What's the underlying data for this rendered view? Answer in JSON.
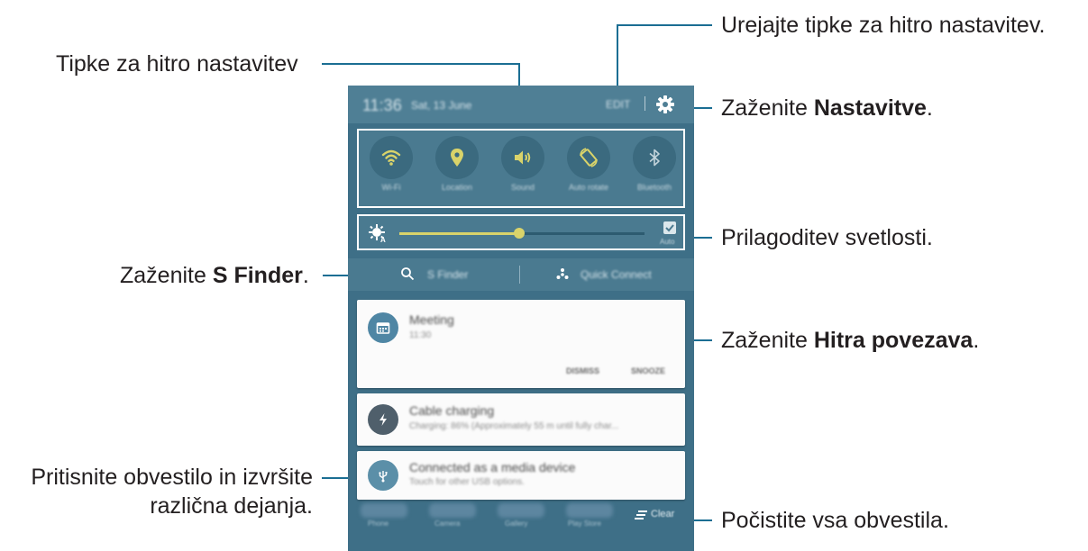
{
  "callouts": {
    "edit_quick": "Urejajte tipke za hitro nastavitev.",
    "quick_buttons": "Tipke za hitro nastavitev",
    "settings_prefix": "Zaženite ",
    "settings_bold": "Nastavitve",
    "settings_suffix": ".",
    "brightness": "Prilagoditev svetlosti.",
    "finder_prefix": "Zaženite ",
    "finder_bold": "S Finder",
    "finder_suffix": ".",
    "quick_connect_prefix": "Zaženite ",
    "quick_connect_bold": "Hitra povezava",
    "quick_connect_suffix": ".",
    "notification_line1": "Pritisnite obvestilo in izvršite",
    "notification_line2": "različna dejanja.",
    "clear_all": "Počistite vsa obvestila."
  },
  "status_bar": {
    "time": "11:36",
    "date": "Sat, 13 June",
    "edit_label": "EDIT"
  },
  "quick_settings": [
    {
      "label": "Wi-Fi",
      "icon": "wifi-icon",
      "active": true
    },
    {
      "label": "Location",
      "icon": "location-icon",
      "active": true
    },
    {
      "label": "Sound",
      "icon": "sound-icon",
      "active": true
    },
    {
      "label": "Auto rotate",
      "icon": "rotate-icon",
      "active": true
    },
    {
      "label": "Bluetooth",
      "icon": "bluetooth-icon",
      "active": false
    }
  ],
  "brightness": {
    "level": 0.49,
    "auto_label": "Auto",
    "auto_checked": true
  },
  "finder_bar": {
    "s_finder": "S Finder",
    "quick_connect": "Quick Connect"
  },
  "notifications": [
    {
      "title": "Meeting",
      "subtitle": "11:30",
      "icon": "calendar-icon",
      "actions": [
        "DISMISS",
        "SNOOZE"
      ]
    },
    {
      "title": "Cable charging",
      "subtitle": "Charging: 86% (Approximately 55 m until fully char...",
      "icon": "lightning-icon"
    },
    {
      "title": "Connected as a media device",
      "subtitle": "Touch for other USB options.",
      "icon": "usb-icon"
    }
  ],
  "dock_apps": [
    "Phone",
    "Camera",
    "Gallery",
    "Play Store"
  ],
  "clear_label": "Clear",
  "colors": {
    "accent": "#d9d36a",
    "panel": "#4a7a90",
    "background": "#3e6f87"
  }
}
